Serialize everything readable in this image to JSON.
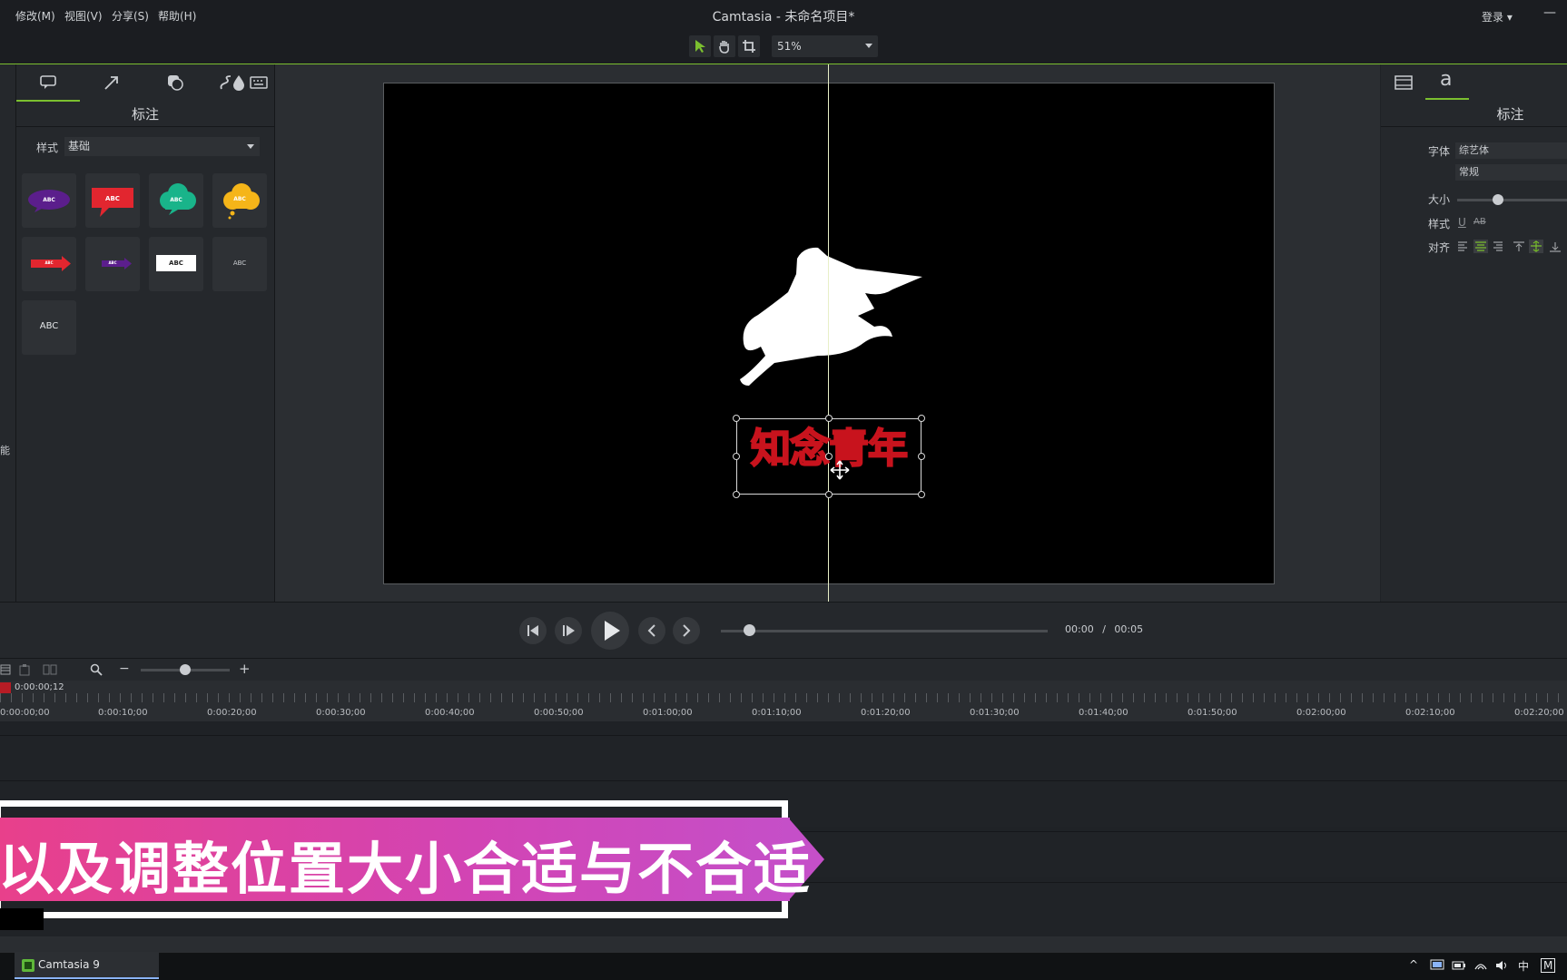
{
  "window": {
    "title": "Camtasia - 未命名项目*",
    "login": "登录",
    "minimize": "—"
  },
  "menu": [
    "修改(M)",
    "视图(V)",
    "分享(S)",
    "帮助(H)"
  ],
  "toolbar": {
    "zoom": "51%"
  },
  "left_panel": {
    "title": "标注",
    "style_label": "样式",
    "style_value": "基础",
    "tiles": [
      "ABC",
      "ABC",
      "ABC",
      "ABC",
      "ABC",
      "ABC",
      "ABC",
      "ABC",
      "ABC"
    ],
    "strip_char": "能"
  },
  "canvas": {
    "callout_text": "知念青年"
  },
  "right_panel": {
    "title": "标注",
    "font_label": "字体",
    "font_value": "综艺体",
    "weight_value": "常规",
    "size_label": "大小",
    "style_label": "样式",
    "underline": "U",
    "strike": "AB",
    "align_label": "对齐"
  },
  "playback": {
    "current": "00:00",
    "separator": "/",
    "total": "00:05"
  },
  "timeline": {
    "playhead": "0:00:00;12",
    "ticks": [
      "0:00:00;00",
      "0:00:10;00",
      "0:00:20;00",
      "0:00:30;00",
      "0:00:40;00",
      "0:00:50;00",
      "0:01:00;00",
      "0:01:10;00",
      "0:01:20;00",
      "0:01:30;00",
      "0:01:40;00",
      "0:01:50;00",
      "0:02:00;00",
      "0:02:10;00",
      "0:02:20;00"
    ]
  },
  "overlay": {
    "banner_text": "以及调整位置大小合适与不合适"
  },
  "taskbar": {
    "app_label": "Camtasia 9",
    "ime_lang": "中",
    "ime_mode": "M"
  },
  "colors": {
    "accent": "#7bbf2f",
    "callout_stroke": "#c8131d"
  }
}
